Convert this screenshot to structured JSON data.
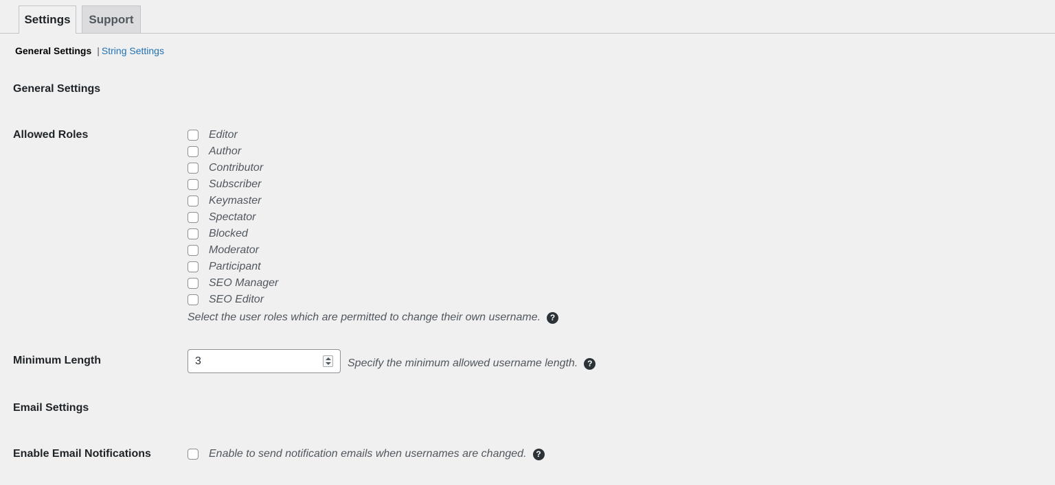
{
  "tabs": {
    "settings": "Settings",
    "support": "Support"
  },
  "subnav": {
    "current": "General Settings",
    "separator": "|",
    "link": "String Settings"
  },
  "general": {
    "title": "General Settings",
    "allowed_roles_label": "Allowed Roles",
    "roles": [
      {
        "label": "Editor",
        "checked": false
      },
      {
        "label": "Author",
        "checked": false
      },
      {
        "label": "Contributor",
        "checked": false
      },
      {
        "label": "Subscriber",
        "checked": false
      },
      {
        "label": "Keymaster",
        "checked": false
      },
      {
        "label": "Spectator",
        "checked": false
      },
      {
        "label": "Blocked",
        "checked": false
      },
      {
        "label": "Moderator",
        "checked": false
      },
      {
        "label": "Participant",
        "checked": false
      },
      {
        "label": "SEO Manager",
        "checked": false
      },
      {
        "label": "SEO Editor",
        "checked": false
      }
    ],
    "roles_description": "Select the user roles which are permitted to change their own username.",
    "min_length_label": "Minimum Length",
    "min_length_value": "3",
    "min_length_description": "Specify the minimum allowed username length."
  },
  "email": {
    "title": "Email Settings",
    "notifications_label": "Enable Email Notifications",
    "notifications_checked": false,
    "notifications_description": "Enable to send notification emails when usernames are changed."
  },
  "help_icon_glyph": "?"
}
